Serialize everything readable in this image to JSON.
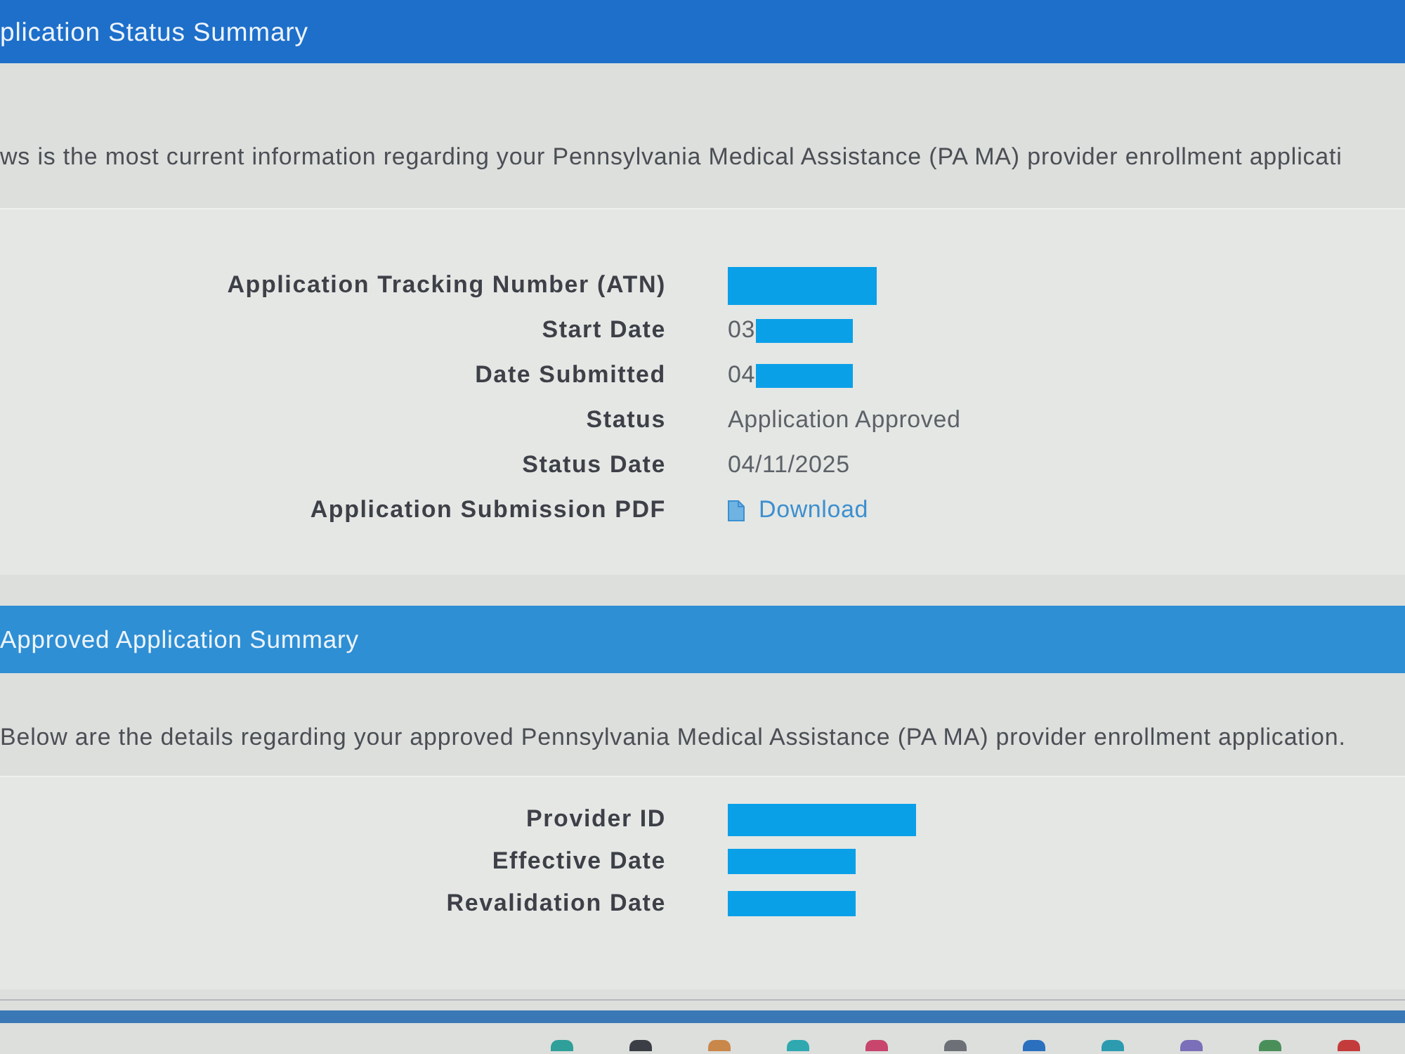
{
  "sections": [
    {
      "title": "plication Status Summary",
      "intro": "ws is the most current information regarding your Pennsylvania Medical Assistance (PA MA) provider enrollment applicati",
      "fields": [
        {
          "label": "Application Tracking Number (ATN)",
          "kind": "text",
          "redacted": true
        },
        {
          "label": "Start Date",
          "kind": "text",
          "value": "03",
          "redacted": true
        },
        {
          "label": "Date Submitted",
          "kind": "text",
          "value": "04",
          "redacted": true
        },
        {
          "label": "Status",
          "kind": "text",
          "value": "Application Approved",
          "redacted": false
        },
        {
          "label": "Status Date",
          "kind": "text",
          "value": "04/11/2025",
          "redacted": false
        },
        {
          "label": "Application Submission PDF",
          "kind": "link",
          "value": "Download",
          "redacted": false
        }
      ]
    },
    {
      "title": "Approved Application Summary",
      "intro": "Below are the details regarding your approved Pennsylvania Medical Assistance (PA MA) provider enrollment application.",
      "fields": [
        {
          "label": "Provider ID",
          "kind": "text",
          "redacted": true
        },
        {
          "label": "Effective Date",
          "kind": "text",
          "redacted": true
        },
        {
          "label": "Revalidation Date",
          "kind": "text",
          "redacted": true
        }
      ]
    }
  ],
  "taskbar": {
    "icons": [
      {
        "color": "#2f9f9a"
      },
      {
        "color": "#3b3f45"
      },
      {
        "color": "#c9874a"
      },
      {
        "color": "#2fa8b0"
      },
      {
        "color": "#c8456e"
      },
      {
        "color": "#6d7177"
      },
      {
        "color": "#2b6fbf"
      },
      {
        "color": "#2c9bb0"
      },
      {
        "color": "#7a6fb8"
      },
      {
        "color": "#4a8f5a"
      },
      {
        "color": "#c43b3b"
      }
    ]
  }
}
